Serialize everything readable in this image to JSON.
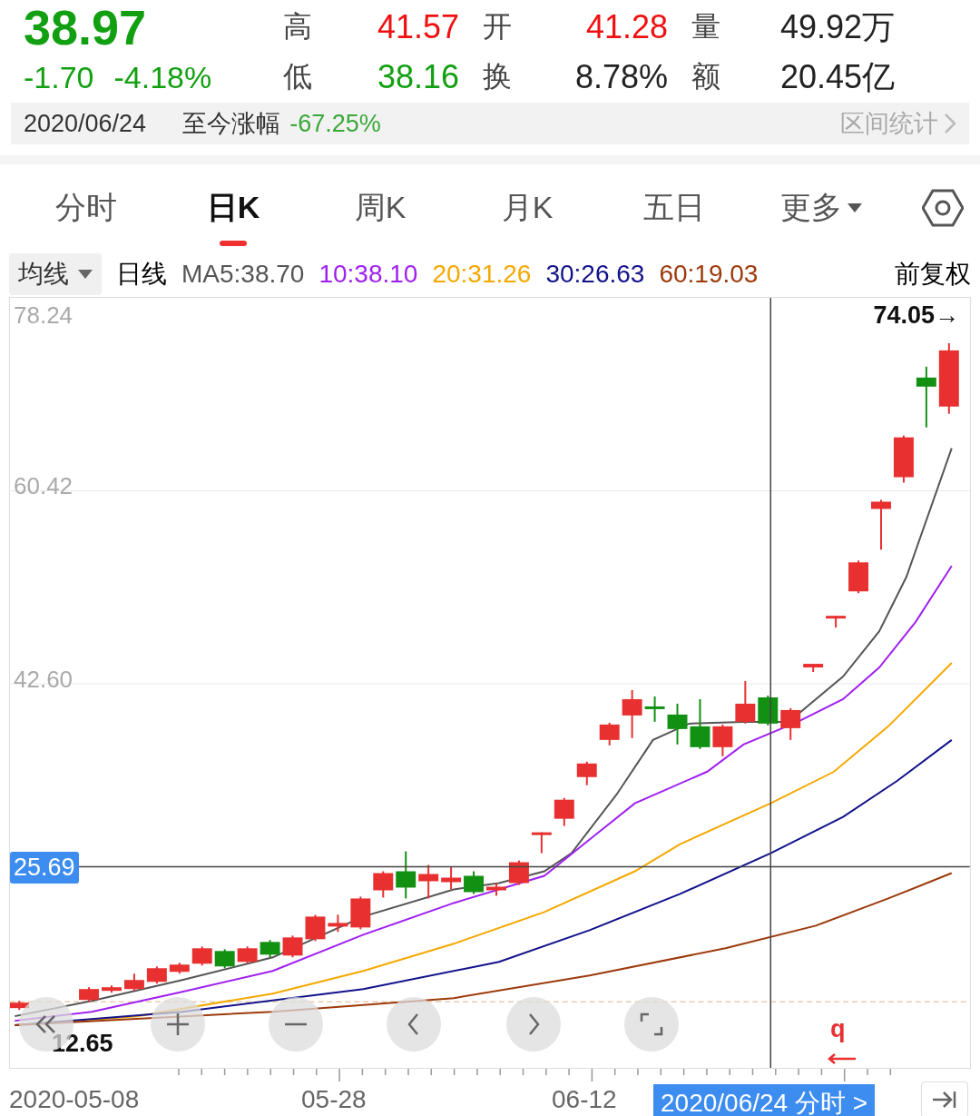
{
  "quote": {
    "price": "38.97",
    "change": "-1.70",
    "change_pct": "-4.18%",
    "color": "#12a012",
    "stats": [
      {
        "label": "高",
        "value": "41.57",
        "color": "#f01010"
      },
      {
        "label": "开",
        "value": "41.28",
        "color": "#f01010"
      },
      {
        "label": "量",
        "value": "49.92万",
        "color": "#222222"
      },
      {
        "label": "低",
        "value": "38.16",
        "color": "#12a012"
      },
      {
        "label": "换",
        "value": "8.78%",
        "color": "#222222"
      },
      {
        "label": "额",
        "value": "20.45亿",
        "color": "#222222"
      }
    ]
  },
  "range_bar": {
    "date": "2020/06/24",
    "label": "至今涨幅",
    "value": "-67.25%",
    "link": "区间统计"
  },
  "tabs": [
    {
      "label": "分时",
      "selected": false
    },
    {
      "label": "日K",
      "selected": true
    },
    {
      "label": "周K",
      "selected": false
    },
    {
      "label": "月K",
      "selected": false
    },
    {
      "label": "五日",
      "selected": false
    },
    {
      "label": "更多",
      "selected": false,
      "kind": "dropdown"
    }
  ],
  "ma_legend": {
    "selector": "均线",
    "period": "日线",
    "items": [
      {
        "text": "MA5:38.70",
        "color": "#555555"
      },
      {
        "text": "10:38.10",
        "color": "#a020f0"
      },
      {
        "text": "20:31.26",
        "color": "#f5a800"
      },
      {
        "text": "30:26.63",
        "color": "#12128c"
      },
      {
        "text": "60:19.03",
        "color": "#9c3a0c"
      }
    ],
    "adjust": "前复权"
  },
  "chart": {
    "y_labels": [
      "78.24",
      "60.42",
      "42.60"
    ],
    "crosshair_price": "25.69",
    "high_marker": "74.05→",
    "low_marker": "12.65",
    "marker": "q",
    "x_labels": [
      "2020-05-08",
      "05-28",
      "06-12"
    ],
    "crosshair_date": "2020/06/24 分时 >"
  },
  "controls": [
    {
      "kind": "rewind"
    },
    {
      "kind": "zoom-in"
    },
    {
      "kind": "zoom-out"
    },
    {
      "kind": "prev"
    },
    {
      "kind": "next"
    },
    {
      "kind": "fullscreen"
    }
  ]
}
